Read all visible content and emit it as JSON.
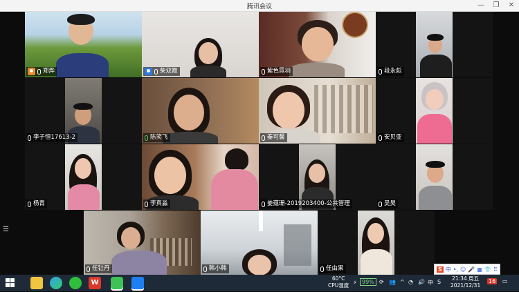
{
  "window": {
    "title": "腾讯会议"
  },
  "participants": [
    {
      "name": "郑烨",
      "role": "host"
    },
    {
      "name": "柴双霞",
      "role": "cohost"
    },
    {
      "name": "紫色霓羽",
      "role": ""
    },
    {
      "name": "段永彪",
      "role": ""
    },
    {
      "name": "李子恒17613-2",
      "role": ""
    },
    {
      "name": "陈笑飞",
      "role": ""
    },
    {
      "name": "秦可馨",
      "role": ""
    },
    {
      "name": "安贝亚",
      "role": ""
    },
    {
      "name": "杨青",
      "role": ""
    },
    {
      "name": "李真淼",
      "role": ""
    },
    {
      "name": "姜蕴珊-2019203400-公共管理",
      "role": ""
    },
    {
      "name": "吴昊",
      "role": ""
    },
    {
      "name": "任钍丹",
      "role": ""
    },
    {
      "name": "韩小韩",
      "role": ""
    },
    {
      "name": "任由果",
      "role": ""
    }
  ],
  "ime": {
    "label": "中"
  },
  "taskbar": {
    "temp": "60°C",
    "temp_label": "CPU温度",
    "battery": "99%",
    "lang": "中",
    "time": "21:34 周五",
    "date": "2021/12/31",
    "notif_count": "16"
  },
  "colors": {
    "taskbar_bg": "#1f2a38",
    "host_badge": "#e8872b",
    "cohost_badge": "#2d7be6"
  }
}
